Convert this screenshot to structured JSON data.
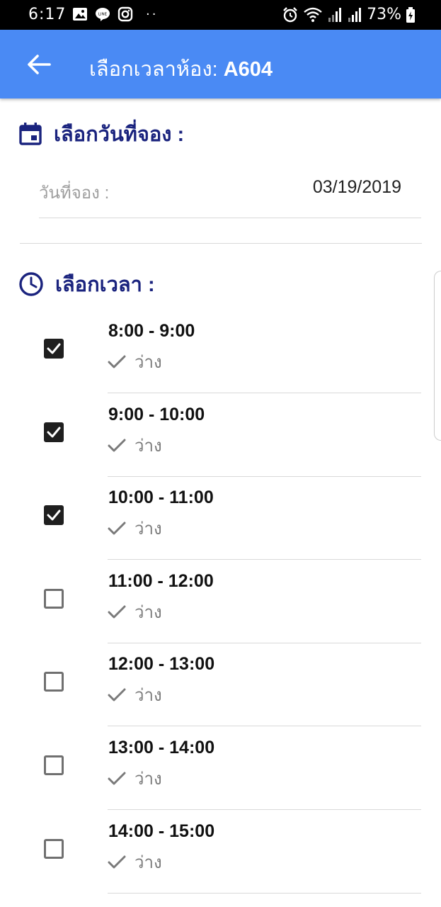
{
  "status_bar": {
    "time": "6:17",
    "battery": "73%"
  },
  "app_bar": {
    "title_prefix": "เลือกเวลาห้อง:",
    "room": "A604",
    "back_icon": "arrow-left-icon"
  },
  "date_section": {
    "icon": "calendar-icon",
    "heading": "เลือกวันที่จอง :",
    "field_label": "วันที่จอง :",
    "field_value": "03/19/2019"
  },
  "time_section": {
    "icon": "clock-icon",
    "heading": "เลือกเวลา :"
  },
  "slots": [
    {
      "time": "8:00 - 9:00",
      "status": "ว่าง",
      "checked": true
    },
    {
      "time": "9:00 - 10:00",
      "status": "ว่าง",
      "checked": true
    },
    {
      "time": "10:00 - 11:00",
      "status": "ว่าง",
      "checked": true
    },
    {
      "time": "11:00 - 12:00",
      "status": "ว่าง",
      "checked": false
    },
    {
      "time": "12:00 - 13:00",
      "status": "ว่าง",
      "checked": false
    },
    {
      "time": "13:00 - 14:00",
      "status": "ว่าง",
      "checked": false
    },
    {
      "time": "14:00 - 15:00",
      "status": "ว่าง",
      "checked": false
    }
  ],
  "colors": {
    "app_bar": "#4a8af4",
    "heading": "#1a237e",
    "checkbox_checked": "#1f1f1f"
  }
}
